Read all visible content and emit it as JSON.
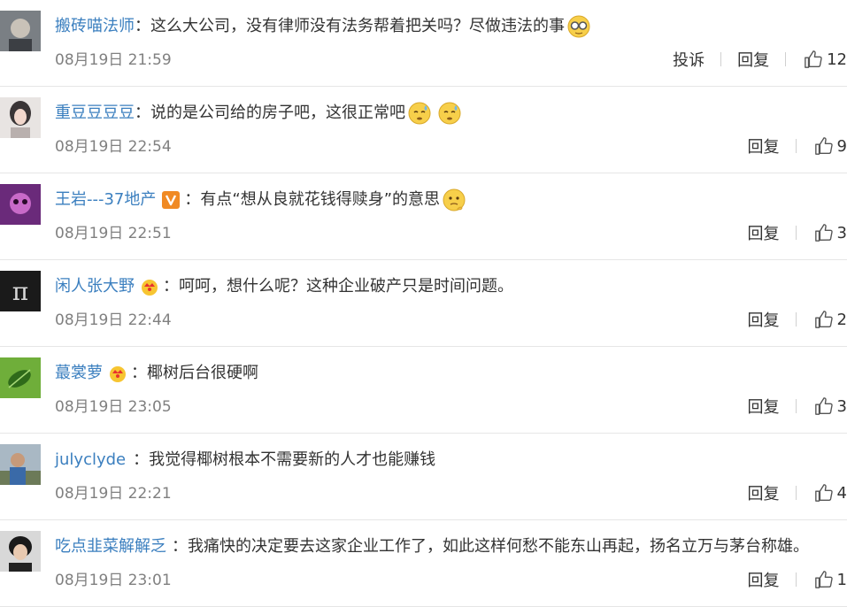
{
  "comments": [
    {
      "username": "搬砖喵法师",
      "text": "：这么大公司，没有律师没有法务帮着把关吗？尽做违法的事",
      "time": "08月19日 21:59",
      "report": "投诉",
      "reply": "回复",
      "likes": "12",
      "emoji": "glasses-emoji"
    },
    {
      "username": "重豆豆豆豆",
      "text": "：说的是公司给的房子吧，这很正常吧",
      "time": "08月19日 22:54",
      "reply": "回复",
      "likes": "9",
      "emoji": "sweat-emoji"
    },
    {
      "username": "王岩---37地产",
      "text": "：有点“想从良就花钱得赎身”的意思",
      "time": "08月19日 22:51",
      "reply": "回复",
      "likes": "3",
      "emoji": "thinking-emoji"
    },
    {
      "username": "闲人张大野",
      "text": "：呵呵，想什么呢？这种企业破产只是时间问题。",
      "time": "08月19日 22:44",
      "reply": "回复",
      "likes": "2"
    },
    {
      "username": "蕞裳萝",
      "text": "：椰树后台很硬啊",
      "time": "08月19日 23:05",
      "reply": "回复",
      "likes": "3"
    },
    {
      "username": "julyclyde",
      "text": "：我觉得椰树根本不需要新的人才也能赚钱",
      "time": "08月19日 22:21",
      "reply": "回复",
      "likes": "4"
    },
    {
      "username": "吃点韭菜解解乏",
      "text": "：我痛快的决定要去这家企业工作了，如此这样何愁不能东山再起，扬名立万与茅台称雄。",
      "time": "08月19日 23:01",
      "reply": "回复",
      "likes": "1"
    }
  ],
  "colors": {
    "username": "#eb7350",
    "username_blue": "#3b7fbf",
    "time": "#808080",
    "divider": "#e6e6e6"
  }
}
